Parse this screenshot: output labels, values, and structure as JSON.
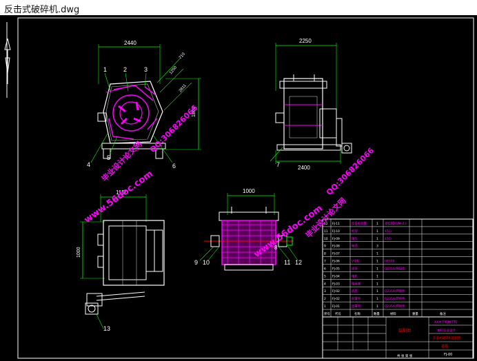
{
  "window": {
    "title": "反击式破碎机.dwg"
  },
  "dimensions": {
    "front_width": "2440",
    "front_d1": "710",
    "front_d2": "1250",
    "front_d3": "2811",
    "front_height": "1860",
    "side_width": "2250",
    "side_base": "2400",
    "top_width": "1150",
    "top_height": "1000",
    "section_width": "1000"
  },
  "part_labels": {
    "p1": "1",
    "p2": "2",
    "p3": "3",
    "p4": "4",
    "p5": "5",
    "p6": "6",
    "p7": "7",
    "p8": "8",
    "p9": "9",
    "p10": "10",
    "p11": "11",
    "p12": "12",
    "p13": "13"
  },
  "watermarks": {
    "site_1": "www.56doc.com",
    "site_2": "www.56doc.com",
    "qq_1": "QQ:306826066",
    "qq_2": "QQ:306826066",
    "brand_1": "毕业设计论文网",
    "brand_2": "毕业设计论文网"
  },
  "bom": {
    "rows": [
      {
        "code": "FJ-11",
        "name": "反击板装置",
        "qty": "1",
        "material": "高锰钢ZGMn13"
      },
      {
        "code": "FJ-10",
        "name": "机架",
        "qty": "1",
        "material": "45Cr"
      },
      {
        "code": "FJ-09",
        "name": "锤头",
        "qty": "1",
        "material": "45Cr"
      },
      {
        "code": "FJ-08",
        "name": "转子",
        "qty": "3",
        "material": ""
      },
      {
        "code": "FJ-07",
        "name": "",
        "qty": "1",
        "material": ""
      },
      {
        "code": "FJ-06",
        "name": "V带轮",
        "qty": "1",
        "material": "HT200"
      },
      {
        "code": "FJ-05",
        "name": "皮带",
        "qty": "1",
        "material": "Q235A/焊接件"
      },
      {
        "code": "FJ-04",
        "name": "电机",
        "qty": "1",
        "material": ""
      },
      {
        "code": "FJ-03",
        "name": "轴承座",
        "qty": "1",
        "material": ""
      },
      {
        "code": "FJ-02",
        "name": "底座",
        "qty": "1",
        "material": "Q235A/焊接件"
      },
      {
        "code": "FJ-02",
        "name": "前罩壳",
        "qty": "1",
        "material": "Q235A/焊接件"
      },
      {
        "code": "FJ-01",
        "name": "后罩壳",
        "qty": "1",
        "material": "Q235A/焊接件"
      }
    ],
    "header": {
      "seq": "序号",
      "code": "代号",
      "name": "名称",
      "qty": "数量",
      "material": "材料",
      "weight": "重量",
      "note": "备注"
    }
  },
  "title_block": {
    "school": "XX大学机械学院",
    "dept": "本科毕业设计",
    "assembly": "装配图",
    "drawing_name": "反击式破碎机装配图",
    "doc_type": "总图",
    "drawing_no": "FJ-00",
    "footer": "共 张  第 张"
  }
}
